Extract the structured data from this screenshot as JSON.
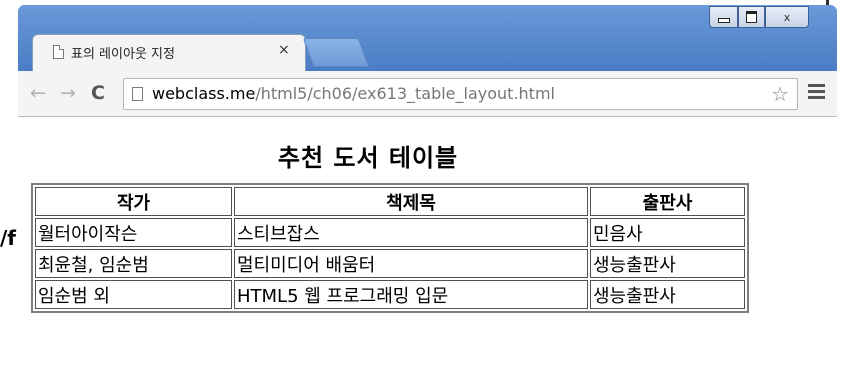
{
  "background": {
    "partial_text": "/f"
  },
  "browser": {
    "tab": {
      "title": "표의 레이아웃 지정",
      "close_glyph": "×"
    },
    "window_controls": {
      "close_glyph": "x"
    },
    "toolbar": {
      "back_glyph": "←",
      "forward_glyph": "→",
      "reload_glyph": "C",
      "url_host": "webclass.me",
      "url_path": "/html5/ch06/ex613_table_layout.html",
      "bookmark_glyph": "☆"
    }
  },
  "page": {
    "title": "추천 도서 테이블",
    "table": {
      "headers": [
        "작가",
        "책제목",
        "출판사"
      ],
      "rows": [
        [
          "월터아이작슨",
          "스티브잡스",
          "민음사"
        ],
        [
          "최윤철, 임순범",
          "멀티미디어 배움터",
          "생능출판사"
        ],
        [
          "임순범 외",
          "HTML5 웹 프로그래밍 입문",
          "생능출판사"
        ]
      ]
    }
  },
  "colors": {
    "window_frame": "#4d7ec4",
    "toolbar": "#f4f4f4",
    "table_border": "#808080"
  }
}
